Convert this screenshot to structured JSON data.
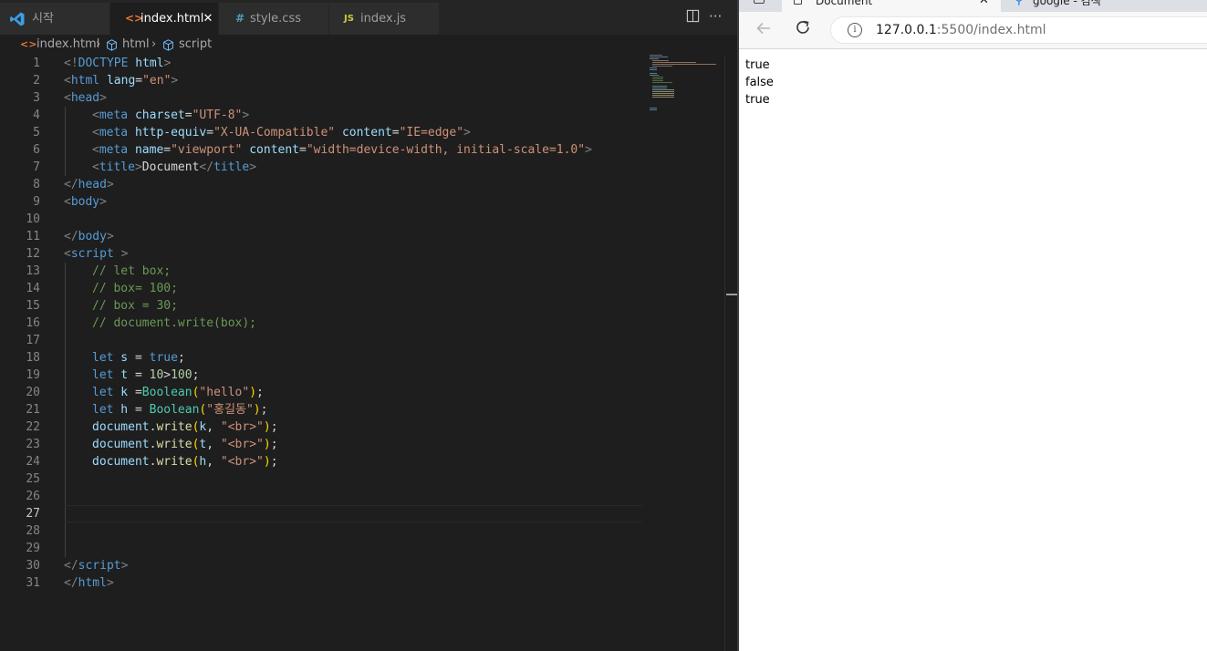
{
  "editor": {
    "tabs": [
      {
        "label": "시작",
        "icon": "vscode-logo-icon"
      },
      {
        "label": "index.html",
        "icon": "html-file-icon",
        "close": "✕"
      },
      {
        "label": "style.css",
        "icon": "css-hash-icon",
        "icon_text": "#"
      },
      {
        "label": "index.js",
        "icon": "js-file-icon",
        "icon_text": "JS"
      }
    ],
    "toolbar": {
      "split_icon": "split-editor-icon",
      "more_icon": "ellipsis-icon"
    },
    "breadcrumb": {
      "file": "index.html",
      "node1": "html",
      "node2": "script",
      "sep": "›"
    },
    "current_line": 27,
    "line_numbers": [
      "1",
      "2",
      "3",
      "4",
      "5",
      "6",
      "7",
      "8",
      "9",
      "10",
      "11",
      "12",
      "13",
      "14",
      "15",
      "16",
      "17",
      "18",
      "19",
      "20",
      "21",
      "22",
      "23",
      "24",
      "25",
      "26",
      "27",
      "28",
      "29",
      "30",
      "31"
    ],
    "code": {
      "l1_a": "<!",
      "l1_b": "DOCTYPE",
      "l1_c": " html",
      "l1_d": ">",
      "l2_a": "<",
      "l2_b": "html",
      "l2_c": " lang",
      "l2_d": "=",
      "l2_e": "\"en\"",
      "l2_f": ">",
      "l3_a": "<",
      "l3_b": "head",
      "l3_c": ">",
      "l4_a": "<",
      "l4_b": "meta",
      "l4_c": " charset",
      "l4_d": "=",
      "l4_e": "\"UTF-8\"",
      "l4_f": ">",
      "l5_a": "<",
      "l5_b": "meta",
      "l5_c": " http-equiv",
      "l5_d": "=",
      "l5_e": "\"X-UA-Compatible\"",
      "l5_f": " content",
      "l5_g": "=",
      "l5_h": "\"IE=edge\"",
      "l5_i": ">",
      "l6_a": "<",
      "l6_b": "meta",
      "l6_c": " name",
      "l6_d": "=",
      "l6_e": "\"viewport\"",
      "l6_f": " content",
      "l6_g": "=",
      "l6_h": "\"width=device-width, initial-scale=1.0\"",
      "l6_i": ">",
      "l7_a": "<",
      "l7_b": "title",
      "l7_c": ">",
      "l7_d": "Document",
      "l7_e": "</",
      "l7_f": "title",
      "l7_g": ">",
      "l8_a": "</",
      "l8_b": "head",
      "l8_c": ">",
      "l9_a": "<",
      "l9_b": "body",
      "l9_c": ">",
      "l11_a": "</",
      "l11_b": "body",
      "l11_c": ">",
      "l12_a": "<",
      "l12_b": "script",
      "l12_c": " >",
      "l13": "// let box;",
      "l14": "// box= 100;",
      "l15": "// box = 30;",
      "l16": "// document.write(box);",
      "l18_a": "let",
      "l18_b": " s",
      "l18_c": " = ",
      "l18_d": "true",
      "l18_e": ";",
      "l19_a": "let",
      "l19_b": " t",
      "l19_c": " = ",
      "l19_d": "10",
      "l19_e": ">",
      "l19_f": "100",
      "l19_g": ";",
      "l20_a": "let",
      "l20_b": " k",
      "l20_c": " =",
      "l20_d": "Boolean",
      "l20_e": "(",
      "l20_f": "\"hello\"",
      "l20_g": ")",
      "l20_h": ";",
      "l21_a": "let",
      "l21_b": " h",
      "l21_c": " = ",
      "l21_d": "Boolean",
      "l21_e": "(",
      "l21_f": "\"홍길동\"",
      "l21_g": ")",
      "l21_h": ";",
      "l22_a": "document",
      "l22_b": ".",
      "l22_c": "write",
      "l22_d": "(",
      "l22_e": "k",
      "l22_f": ", ",
      "l22_g": "\"<br>\"",
      "l22_h": ")",
      "l22_i": ";",
      "l23_a": "document",
      "l23_b": ".",
      "l23_c": "write",
      "l23_d": "(",
      "l23_e": "t",
      "l23_f": ", ",
      "l23_g": "\"<br>\"",
      "l23_h": ")",
      "l23_i": ";",
      "l24_a": "document",
      "l24_b": ".",
      "l24_c": "write",
      "l24_d": "(",
      "l24_e": "h",
      "l24_f": ", ",
      "l24_g": "\"<br>\"",
      "l24_h": ")",
      "l24_i": ";",
      "l30_a": "</",
      "l30_b": "script",
      "l30_c": ">",
      "l31_a": "</",
      "l31_b": "html",
      "l31_c": ">"
    }
  },
  "browser": {
    "tabs": [
      {
        "label": "Document",
        "icon": "page-icon",
        "close": "✕"
      },
      {
        "label": "google - 검색",
        "icon": "search-icon"
      }
    ],
    "nav": {
      "back_icon": "back-arrow-icon",
      "reload_icon": "reload-icon",
      "info_icon": "info-icon",
      "info_text": "i"
    },
    "url_host": "127.0.0.1",
    "url_rest": ":5500/index.html",
    "output": [
      "true",
      "false",
      "true"
    ]
  },
  "colors": {
    "editor_bg": "#1e1e1e",
    "tabbar_bg": "#252526",
    "tag": "#569cd6",
    "attr": "#9cdcfe",
    "string": "#ce9178",
    "comment": "#6a9955",
    "function": "#dcdcaa",
    "number": "#b5cea8",
    "class": "#4ec9b0"
  }
}
